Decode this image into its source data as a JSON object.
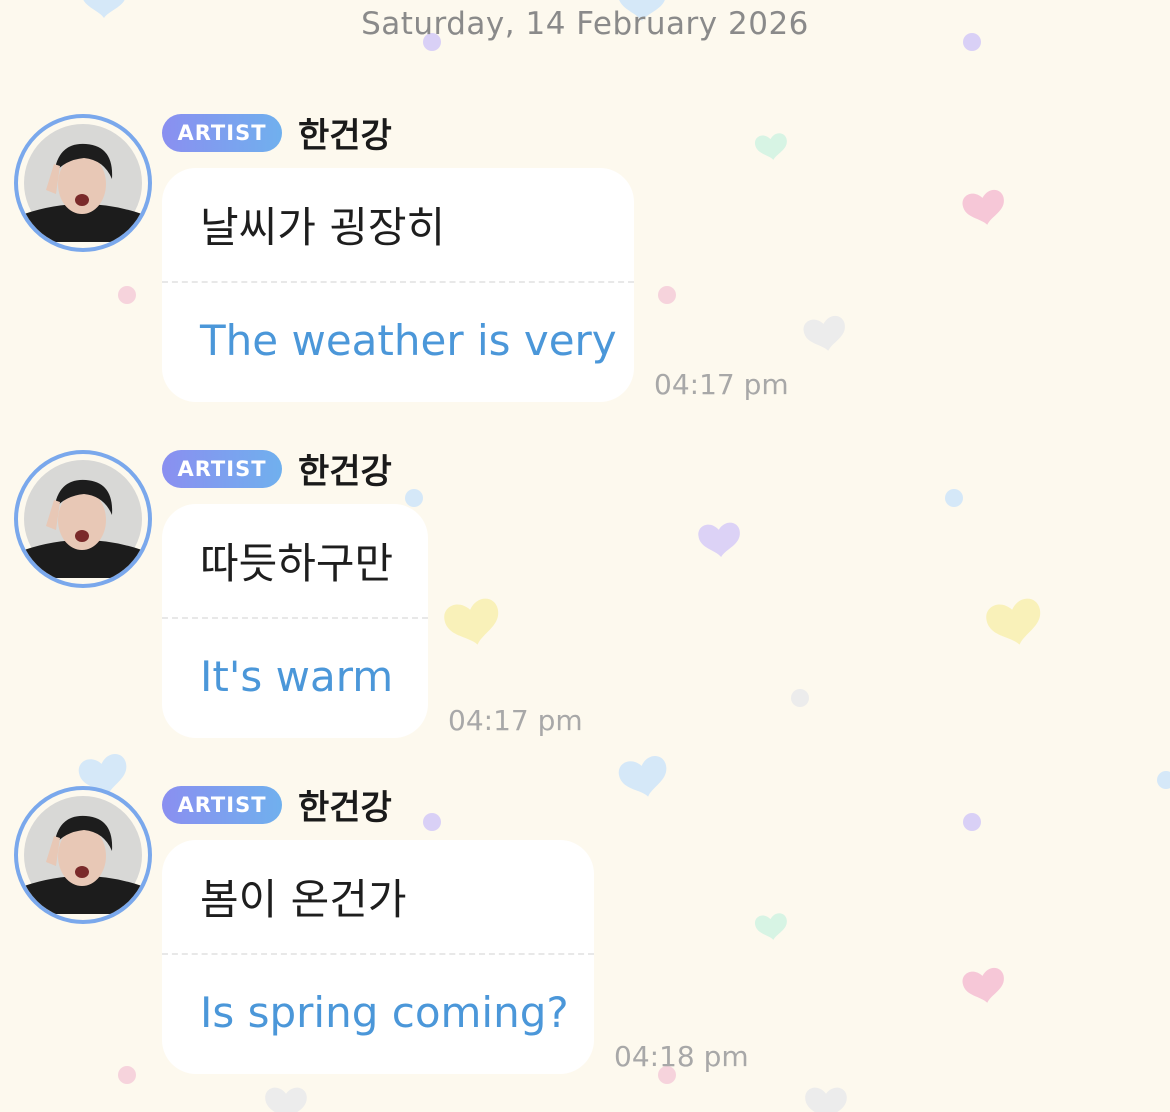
{
  "date_separator": "Saturday, 14 February 2026",
  "messages": [
    {
      "badge": "ARTIST",
      "author": "한건강",
      "text": "날씨가 굉장히",
      "translation": "The weather is very",
      "time": "04:17 pm"
    },
    {
      "badge": "ARTIST",
      "author": "한건강",
      "text": "따듯하구만",
      "translation": "It's warm",
      "time": "04:17 pm"
    },
    {
      "badge": "ARTIST",
      "author": "한건강",
      "text": "봄이 온건가",
      "translation": "Is spring coming?",
      "time": "04:18 pm"
    }
  ],
  "colors": {
    "background": "#fdf9ee",
    "translation_text": "#4b97d9",
    "avatar_ring": "#7aa8ec",
    "badge_gradient_start": "#8a8ff0",
    "badge_gradient_end": "#70b0ee"
  },
  "icons": {
    "background_pattern": "heart-dot-pattern",
    "avatar": "user-avatar-photo"
  }
}
